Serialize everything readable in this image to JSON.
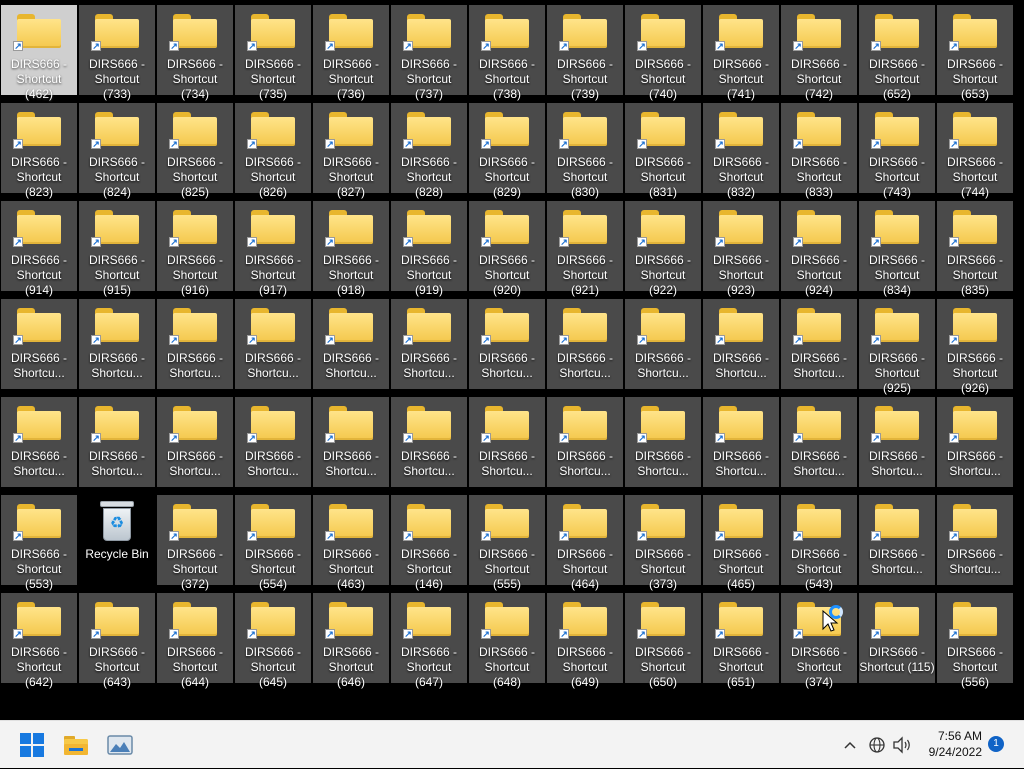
{
  "desktop": {
    "selected_index": 0,
    "rows": [
      [
        "DIRS666 -\nShortcut (462)",
        "DIRS666 -\nShortcut (733)",
        "DIRS666 -\nShortcut (734)",
        "DIRS666 -\nShortcut (735)",
        "DIRS666 -\nShortcut (736)",
        "DIRS666 -\nShortcut (737)",
        "DIRS666 -\nShortcut (738)",
        "DIRS666 -\nShortcut (739)",
        "DIRS666 -\nShortcut (740)",
        "DIRS666 -\nShortcut (741)",
        "DIRS666 -\nShortcut (742)",
        "DIRS666 -\nShortcut (652)",
        "DIRS666 -\nShortcut (653)"
      ],
      [
        "DIRS666 -\nShortcut (823)",
        "DIRS666 -\nShortcut (824)",
        "DIRS666 -\nShortcut (825)",
        "DIRS666 -\nShortcut (826)",
        "DIRS666 -\nShortcut (827)",
        "DIRS666 -\nShortcut (828)",
        "DIRS666 -\nShortcut (829)",
        "DIRS666 -\nShortcut (830)",
        "DIRS666 -\nShortcut (831)",
        "DIRS666 -\nShortcut (832)",
        "DIRS666 -\nShortcut (833)",
        "DIRS666 -\nShortcut (743)",
        "DIRS666 -\nShortcut (744)"
      ],
      [
        "DIRS666 -\nShortcut (914)",
        "DIRS666 -\nShortcut (915)",
        "DIRS666 -\nShortcut (916)",
        "DIRS666 -\nShortcut (917)",
        "DIRS666 -\nShortcut (918)",
        "DIRS666 -\nShortcut (919)",
        "DIRS666 -\nShortcut (920)",
        "DIRS666 -\nShortcut (921)",
        "DIRS666 -\nShortcut (922)",
        "DIRS666 -\nShortcut (923)",
        "DIRS666 -\nShortcut (924)",
        "DIRS666 -\nShortcut (834)",
        "DIRS666 -\nShortcut (835)"
      ],
      [
        "DIRS666 -\nShortcu...",
        "DIRS666 -\nShortcu...",
        "DIRS666 -\nShortcu...",
        "DIRS666 -\nShortcu...",
        "DIRS666 -\nShortcu...",
        "DIRS666 -\nShortcu...",
        "DIRS666 -\nShortcu...",
        "DIRS666 -\nShortcu...",
        "DIRS666 -\nShortcu...",
        "DIRS666 -\nShortcu...",
        "DIRS666 -\nShortcu...",
        "DIRS666 -\nShortcut (925)",
        "DIRS666 -\nShortcut (926)"
      ],
      [
        "DIRS666 -\nShortcu...",
        "DIRS666 -\nShortcu...",
        "DIRS666 -\nShortcu...",
        "DIRS666 -\nShortcu...",
        "DIRS666 -\nShortcu...",
        "DIRS666 -\nShortcu...",
        "DIRS666 -\nShortcu...",
        "DIRS666 -\nShortcu...",
        "DIRS666 -\nShortcu...",
        "DIRS666 -\nShortcu...",
        "DIRS666 -\nShortcu...",
        "DIRS666 -\nShortcu...",
        "DIRS666 -\nShortcu..."
      ],
      [
        "DIRS666 -\nShortcut (553)",
        "Recycle Bin",
        "DIRS666 -\nShortcut (372)",
        "DIRS666 -\nShortcut (554)",
        "DIRS666 -\nShortcut (463)",
        "DIRS666 -\nShortcut (146)",
        "DIRS666 -\nShortcut (555)",
        "DIRS666 -\nShortcut (464)",
        "DIRS666 -\nShortcut (373)",
        "DIRS666 -\nShortcut (465)",
        "DIRS666 -\nShortcut (543)",
        "DIRS666 -\nShortcu...",
        "DIRS666 -\nShortcu..."
      ],
      [
        "DIRS666 -\nShortcut (642)",
        "DIRS666 -\nShortcut (643)",
        "DIRS666 -\nShortcut (644)",
        "DIRS666 -\nShortcut (645)",
        "DIRS666 -\nShortcut (646)",
        "DIRS666 -\nShortcut (647)",
        "DIRS666 -\nShortcut (648)",
        "DIRS666 -\nShortcut (649)",
        "DIRS666 -\nShortcut (650)",
        "DIRS666 -\nShortcut (651)",
        "DIRS666 -\nShortcut (374)",
        "DIRS666 -\nShortcut (115)",
        "DIRS666 -\nShortcut (556)"
      ]
    ],
    "shortcut_glyph": "↗",
    "recycle_symbol": "♻"
  },
  "taskbar": {
    "start_icon": "windows-start-icon",
    "pinned": [
      "file-explorer-icon",
      "photos-icon"
    ],
    "tray": {
      "chevron": "^",
      "network_icon": "globe-icon",
      "volume_icon": "speaker-icon"
    },
    "clock": {
      "time": "7:56 AM",
      "date": "9/24/2022"
    },
    "notification_count": "1"
  },
  "colors": {
    "accent": "#1779e0",
    "folder_yellow": "#f4c84c",
    "tile_bg": "#4a4a4a",
    "selected_bg": "#cfcfcf"
  }
}
